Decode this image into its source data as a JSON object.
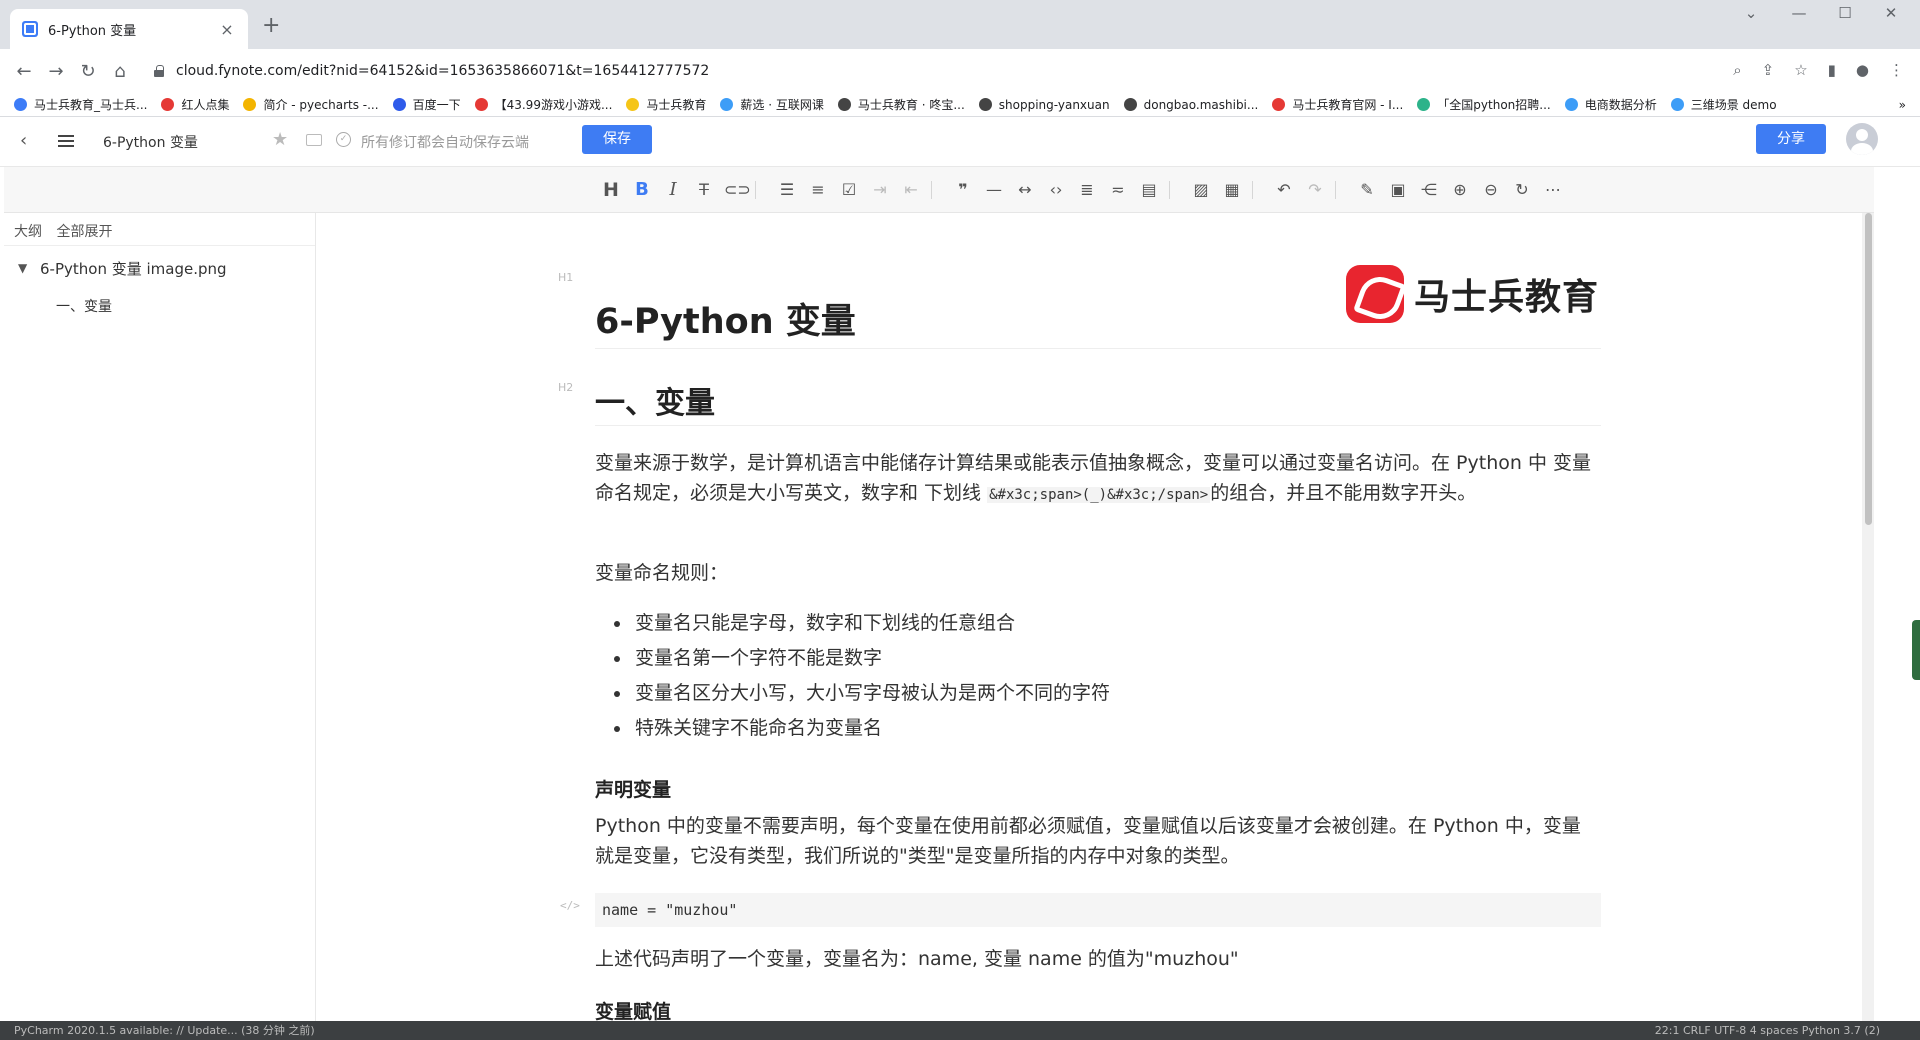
{
  "browser": {
    "tab_title": "6-Python 变量",
    "tab_close": "×",
    "new_tab": "+",
    "url": "cloud.fynote.com/edit?nid=64152&id=1653635866071&t=1654412777572",
    "bookmarks": [
      {
        "label": "马士兵教育_马士兵...",
        "color": "#3d7cf7"
      },
      {
        "label": "红人点集",
        "color": "#e53935"
      },
      {
        "label": "简介 - pyecharts -...",
        "color": "#f3b400"
      },
      {
        "label": "百度一下",
        "color": "#2f5bea"
      },
      {
        "label": "【43.99游戏小游戏...",
        "color": "#e53935"
      },
      {
        "label": "马士兵教育",
        "color": "#f5c518"
      },
      {
        "label": "薪选 · 互联网课",
        "color": "#3d9df7"
      },
      {
        "label": "马士兵教育 · 咚宝...",
        "color": "#444444"
      },
      {
        "label": "shopping-yanxuan",
        "color": "#444444"
      },
      {
        "label": "dongbao.mashibi...",
        "color": "#444444"
      },
      {
        "label": "马士兵教育官网 - I...",
        "color": "#e53935"
      },
      {
        "label": "「全国python招聘...",
        "color": "#2db38a"
      },
      {
        "label": "电商数据分析",
        "color": "#3d9df7"
      },
      {
        "label": "三维场景 demo",
        "color": "#3d9df7"
      }
    ],
    "bookmarks_more": "»"
  },
  "app": {
    "doc_title": "6-Python 变量",
    "autosave_text": "所有修订都会自动保存云端",
    "save_label": "保存",
    "share_label": "分享",
    "accent_color": "#3e7cf3"
  },
  "sidebar": {
    "outline_label": "大纲",
    "expand_all_label": "全部展开",
    "items": [
      {
        "label": "6-Python 变量 image.png",
        "level": 1
      },
      {
        "label": "一、变量",
        "level": 2
      }
    ]
  },
  "document": {
    "h1_tag": "H1",
    "h2_tag": "H2",
    "title": "6-Python 变量",
    "logo_text": "马士兵教育",
    "section_title": "一、变量",
    "intro_part1": "变量来源于数学，是计算机语言中能储存计算结果或能表示值抽象概念，变量可以通过变量名访问。在 Python 中 变量命名规定，必须是大小写英文，数字和 下划线 ",
    "intro_code": "&#x3c;span>(_)&#x3c;/span>",
    "intro_part2": "的组合，并且不能用数字开头。",
    "rules_heading": "变量命名规则：",
    "rules": [
      "变量名只能是字母，数字和下划线的任意组合",
      "变量名第一个字符不能是数字",
      "变量名区分大小写，大小写字母被认为是两个不同的字符",
      "特殊关键字不能命名为变量名"
    ],
    "declare_heading": "声明变量",
    "declare_text": "Python 中的变量不需要声明，每个变量在使用前都必须赋值，变量赋值以后该变量才会被创建。在 Python 中，变量就是变量，它没有类型，我们所说的\"类型\"是变量所指的内存中对象的类型。",
    "code_tag": "</>",
    "code_line": "name = \"muzhou\"",
    "code_explain": "上述代码声明了一个变量，变量名为：name, 变量 name 的值为\"muzhou\"",
    "assign_heading": "变量赋值"
  },
  "statusbar": {
    "left_text": "PyCharm 2020.1.5 available: // Update... (38 分钟 之前)",
    "right_text": "22:1   CRLF   UTF-8   4 spaces   Python 3.7 (2)"
  }
}
